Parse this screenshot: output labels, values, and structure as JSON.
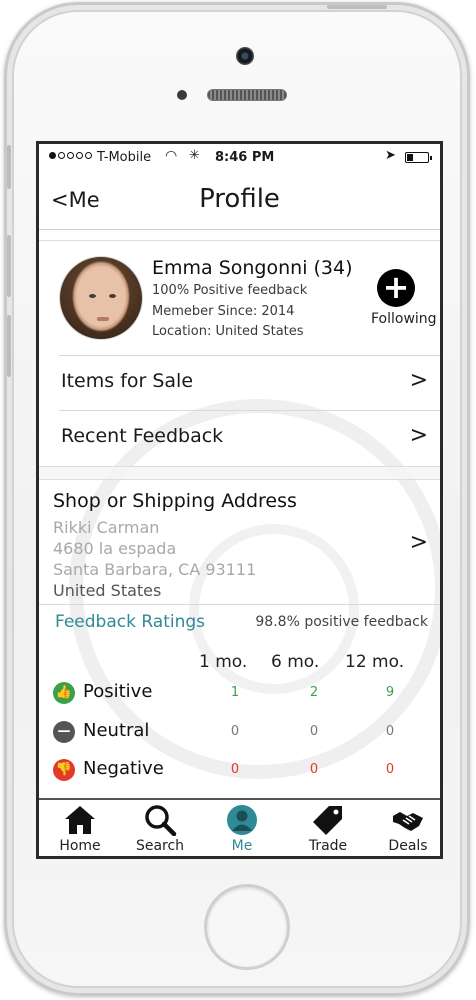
{
  "status_bar": {
    "carrier": "T-Mobile",
    "time": "8:46 PM",
    "signal_bars": 1,
    "battery_level": 0.3
  },
  "nav": {
    "back_label": "<Me",
    "title": "Profile"
  },
  "profile": {
    "name": "Emma Songonni (34)",
    "feedback": "100% Positive feedback",
    "member_since": "Memeber Since: 2014",
    "location": "Location: United States",
    "follow_label": "Following",
    "follow_icon": "plus-icon"
  },
  "menu": {
    "items_for_sale": "Items for Sale",
    "recent_feedback": "Recent Feedback",
    "chevron": ">"
  },
  "address": {
    "heading": "Shop or Shipping Address",
    "name": "Rikki Carman",
    "street": "4680 la espada",
    "city": "Santa Barbara, CA 93111",
    "country": "United States"
  },
  "ratings": {
    "tab_label": "Feedback Ratings",
    "positive_pct": "98.8% positive feedback",
    "periods": [
      "1 mo.",
      "6 mo.",
      "12 mo."
    ],
    "rows": [
      {
        "label": "Positive",
        "values": [
          "1",
          "2",
          "9"
        ],
        "color": "#3aa04a"
      },
      {
        "label": "Neutral",
        "values": [
          "0",
          "0",
          "0"
        ],
        "color": "#555555"
      },
      {
        "label": "Negative",
        "values": [
          "0",
          "0",
          "0"
        ],
        "color": "#e23a2a"
      }
    ]
  },
  "tabbar": {
    "items": [
      {
        "label": "Home",
        "icon": "home-icon"
      },
      {
        "label": "Search",
        "icon": "search-icon"
      },
      {
        "label": "Me",
        "icon": "user-icon"
      },
      {
        "label": "Trade",
        "icon": "tag-icon"
      },
      {
        "label": "Deals",
        "icon": "handshake-icon"
      }
    ],
    "active": "Me",
    "active_color": "#2e8a95"
  }
}
